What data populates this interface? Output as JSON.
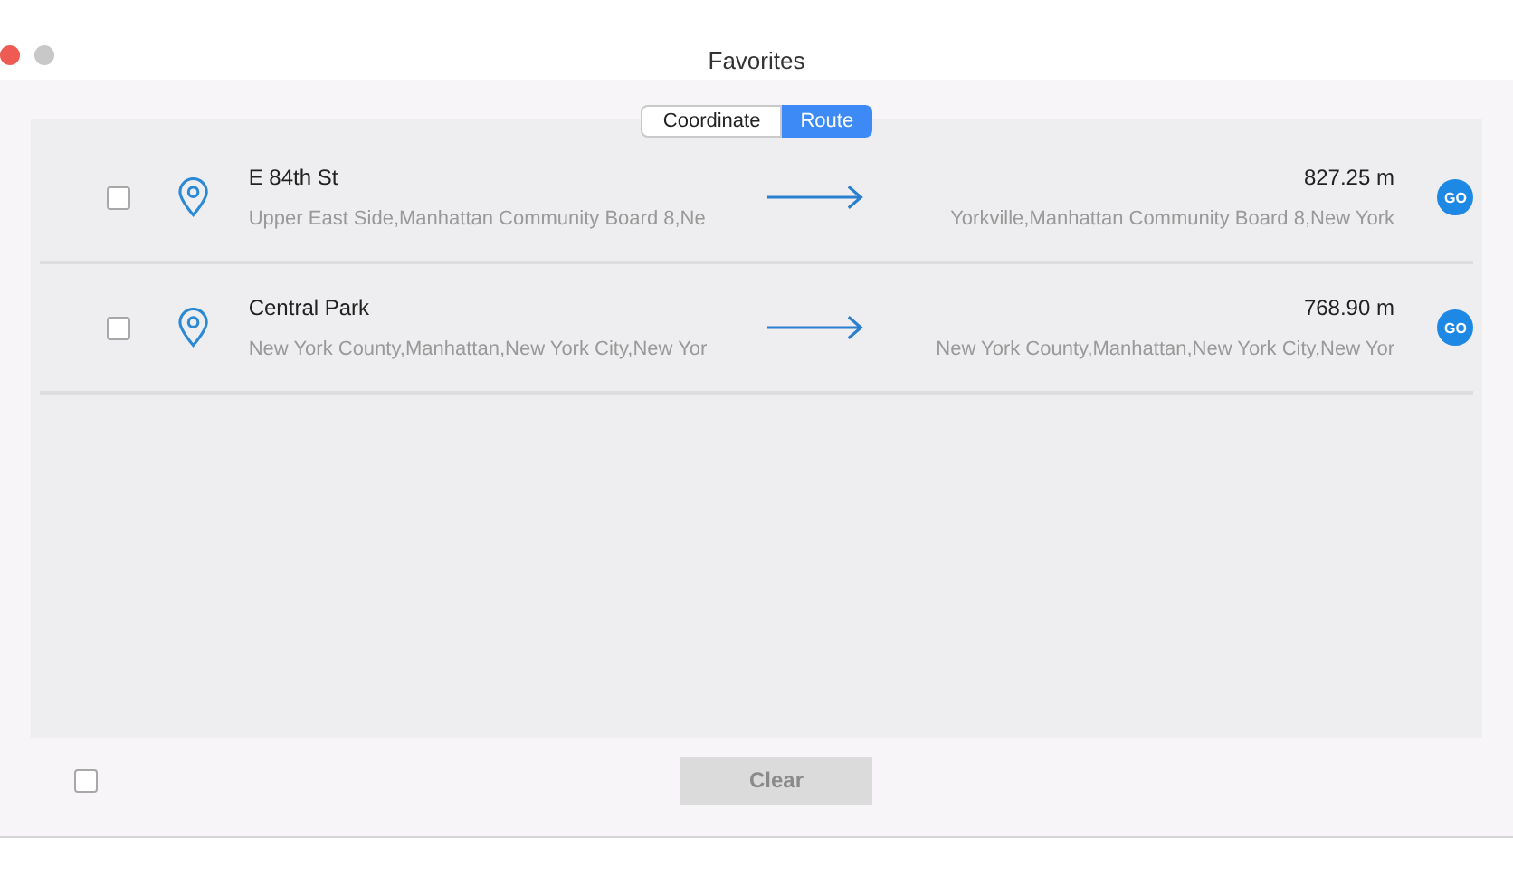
{
  "window": {
    "title": "Favorites",
    "buttons": [
      {
        "kind": "close"
      },
      {
        "kind": "minimize"
      }
    ]
  },
  "tabs": [
    {
      "label": "Coordinate",
      "selected": false
    },
    {
      "label": "Route",
      "selected": true
    }
  ],
  "routes": [
    {
      "checked": false,
      "from_name": "E 84th St",
      "from_address": "Upper East Side,Manhattan Community Board 8,Ne",
      "distance": "827.25 m",
      "to_address": "Yorkville,Manhattan Community Board 8,New York",
      "go": "GO"
    },
    {
      "checked": false,
      "from_name": "Central Park",
      "from_address": "New York County,Manhattan,New York City,New Yor",
      "distance": "768.90 m",
      "to_address": "New York County,Manhattan,New York City,New Yor",
      "go": "GO"
    }
  ],
  "footer": {
    "select_all_checked": false,
    "clear_button": {
      "label": "Clear",
      "disabled": true
    }
  }
}
